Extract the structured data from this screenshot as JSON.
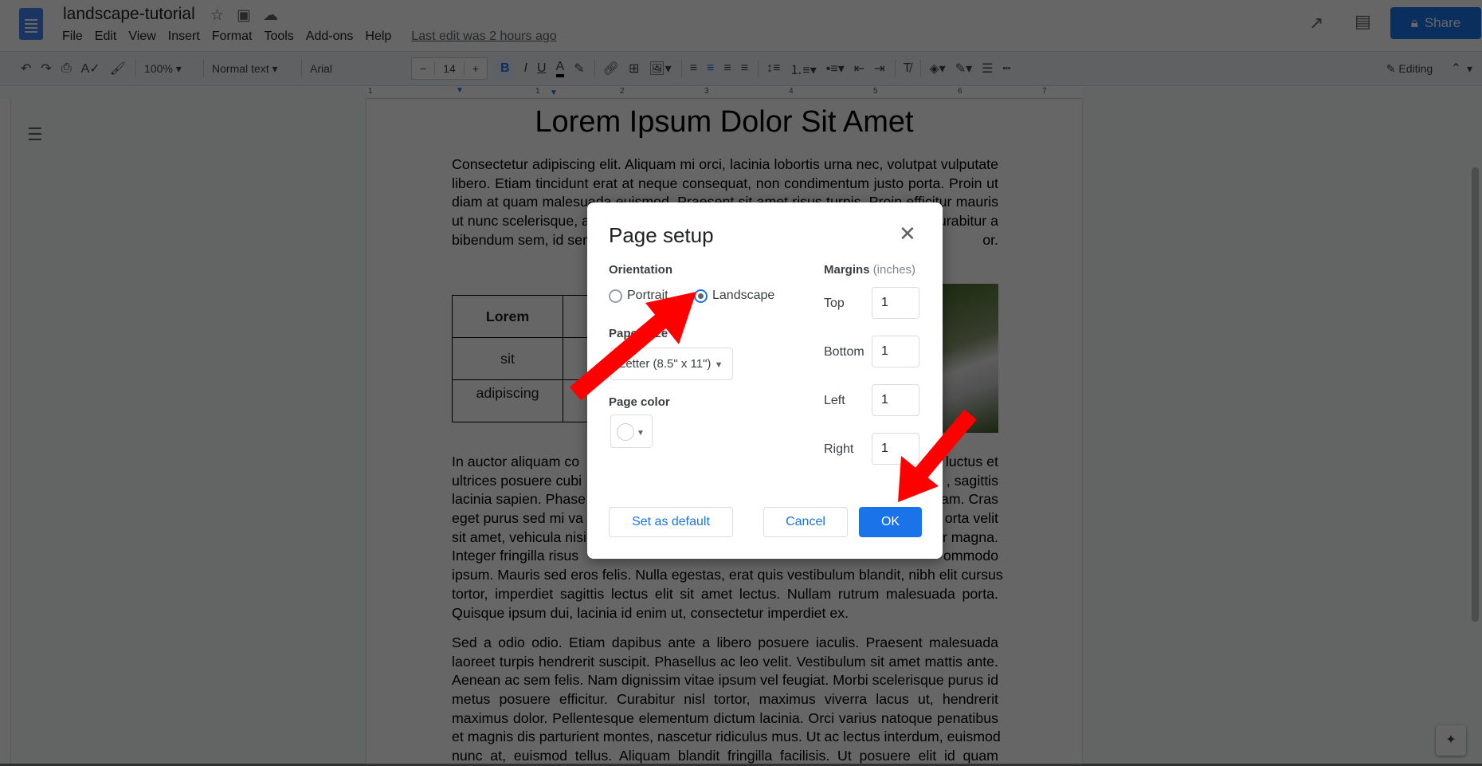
{
  "header": {
    "doc_title": "landscape-tutorial",
    "menu": [
      "File",
      "Edit",
      "View",
      "Insert",
      "Format",
      "Tools",
      "Add-ons",
      "Help"
    ],
    "last_edit": "Last edit was 2 hours ago",
    "share_label": "Share"
  },
  "toolbar": {
    "zoom": "100%",
    "style": "Normal text",
    "font": "Arial",
    "font_size": "14",
    "minus": "−",
    "plus": "+",
    "bold": "B",
    "italic": "I",
    "underline": "U",
    "text_color": "A",
    "mode": "Editing"
  },
  "ruler": [
    "1",
    "1",
    "2",
    "3",
    "4",
    "5",
    "6",
    "7"
  ],
  "document": {
    "title": "Lorem Ipsum Dolor Sit Amet",
    "para1": [
      {
        "text": "Consectetur adipiscing elit. Aliquam mi orci, lacinia lobortis urna nec, volutpat vulputate"
      },
      {
        "text": "libero. Etiam tincidunt erat at neque consequat, non condimentum justo porta. Proin ut"
      },
      {
        "text": "diam at quam malesuada euismod. Praesent sit amet risus turpis. Proin efficitur mauris"
      },
      {
        "left": "ut nunc scelerisque, a",
        "right": "urabitur a"
      },
      {
        "left": "bibendum sem, id sem",
        "right": "or."
      }
    ],
    "table": [
      [
        "Lorem",
        ""
      ],
      [
        "sit",
        ""
      ],
      [
        "adipiscing",
        ""
      ]
    ],
    "para2": [
      {
        "left": "In auctor aliquam co",
        "right": "luctus et"
      },
      {
        "left": "ultrices posuere cubi",
        "right": ", sagittis"
      },
      {
        "left": "lacinia sapien. Phase",
        "right": "am. Cras"
      },
      {
        "left": "eget purus sed mi va",
        "right": "orta velit"
      },
      {
        "left": "sit amet, vehicula nisi",
        "right": "r magna."
      },
      {
        "left": "Integer fringilla risus",
        "right": "ommodo"
      },
      {
        "text": "ipsum. Mauris sed eros felis. Nulla egestas, erat quis vestibulum blandit, nibh elit cursus"
      },
      {
        "text": "tortor, imperdiet sagittis lectus elit sit amet lectus. Nullam rutrum malesuada porta."
      },
      {
        "text": "Quisque ipsum dui, lacinia id enim ut, consectetur imperdiet ex.",
        "last": true
      }
    ],
    "para3": [
      {
        "text": "Sed a odio odio. Etiam dapibus ante a libero posuere iaculis. Praesent malesuada"
      },
      {
        "text": "laoreet turpis hendrerit suscipit. Phasellus ac leo velit. Vestibulum sit amet mattis ante."
      },
      {
        "text": "Aenean ac sem felis. Nam dignissim vitae ipsum vel feugiat. Morbi scelerisque purus id"
      },
      {
        "text": "metus posuere efficitur. Curabitur nisl tortor, maximus viverra lacus ut, hendrerit"
      },
      {
        "text": "maximus dolor. Pellentesque elementum dictum lacinia. Orci varius natoque penatibus"
      },
      {
        "text": "et magnis dis parturient montes, nascetur ridiculus mus. Ut ac lectus interdum, euismod"
      },
      {
        "text": "nunc at, euismod tellus. Aliquam blandit fringilla facilisis. Ut posuere elit id quam"
      }
    ]
  },
  "dialog": {
    "title": "Page setup",
    "orientation_label": "Orientation",
    "portrait": "Portrait",
    "landscape": "Landscape",
    "selected_orientation": "Landscape",
    "paper_size_label": "Paper size",
    "paper_size": "Letter (8.5\" x 11\")",
    "page_color_label": "Page color",
    "page_color": "#ffffff",
    "margins_label": "Margins",
    "margins_unit": "(inches)",
    "margins": [
      {
        "label": "Top",
        "value": "1"
      },
      {
        "label": "Bottom",
        "value": "1"
      },
      {
        "label": "Left",
        "value": "1"
      },
      {
        "label": "Right",
        "value": "1"
      }
    ],
    "set_default": "Set as default",
    "cancel": "Cancel",
    "ok": "OK"
  },
  "colors": {
    "accent": "#1a73e8",
    "annotation_arrow": "#ff0000"
  }
}
